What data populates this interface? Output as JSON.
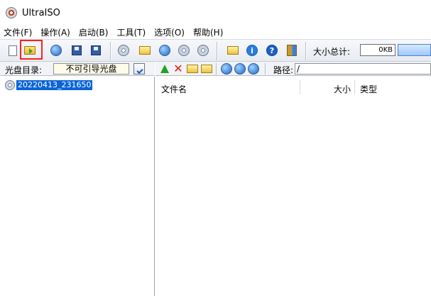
{
  "window": {
    "title": "UltraISO"
  },
  "menu": [
    "文件(F)",
    "操作(A)",
    "启动(B)",
    "工具(T)",
    "选项(O)",
    "帮助(H)"
  ],
  "toolbar": {
    "icons": [
      "new-icon",
      "open-icon",
      "extract-icon",
      "save-icon",
      "save-as-icon",
      "virtual-drive-icon",
      "properties-icon",
      "compress-icon",
      "burn-icon",
      "mount-icon",
      "convert-icon",
      "info-icon",
      "help-icon",
      "exit-icon"
    ],
    "size_label": "大小总计:",
    "size_value": "0KB"
  },
  "left_panel": {
    "caption": "光盘目录:",
    "boot_status": "不可引导光盘",
    "tree_item": "20220413_231650"
  },
  "right_panel": {
    "path_label": "路径:",
    "path_value": "/",
    "columns": [
      "文件名",
      "大小",
      "类型"
    ]
  },
  "colors": {
    "selection": "#0a64d8",
    "highlight": "#ff2020"
  }
}
